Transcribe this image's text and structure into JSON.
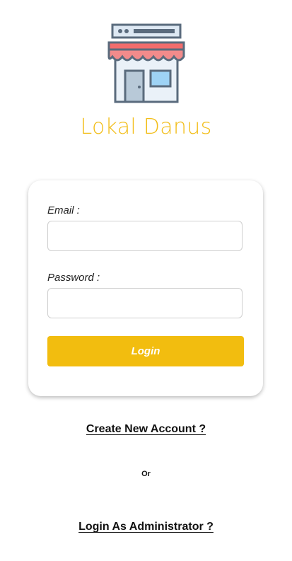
{
  "app": {
    "logo_icon": "storefront-icon",
    "title": "Lokal Danus",
    "accent_color": "#f2bd0f"
  },
  "login_form": {
    "email_label": "Email :",
    "email_value": "",
    "password_label": "Password :",
    "password_value": "",
    "login_button_label": "Login"
  },
  "links": {
    "create_account": "Create New Account ?",
    "separator": "Or",
    "admin_login": "Login As Administrator ?"
  }
}
